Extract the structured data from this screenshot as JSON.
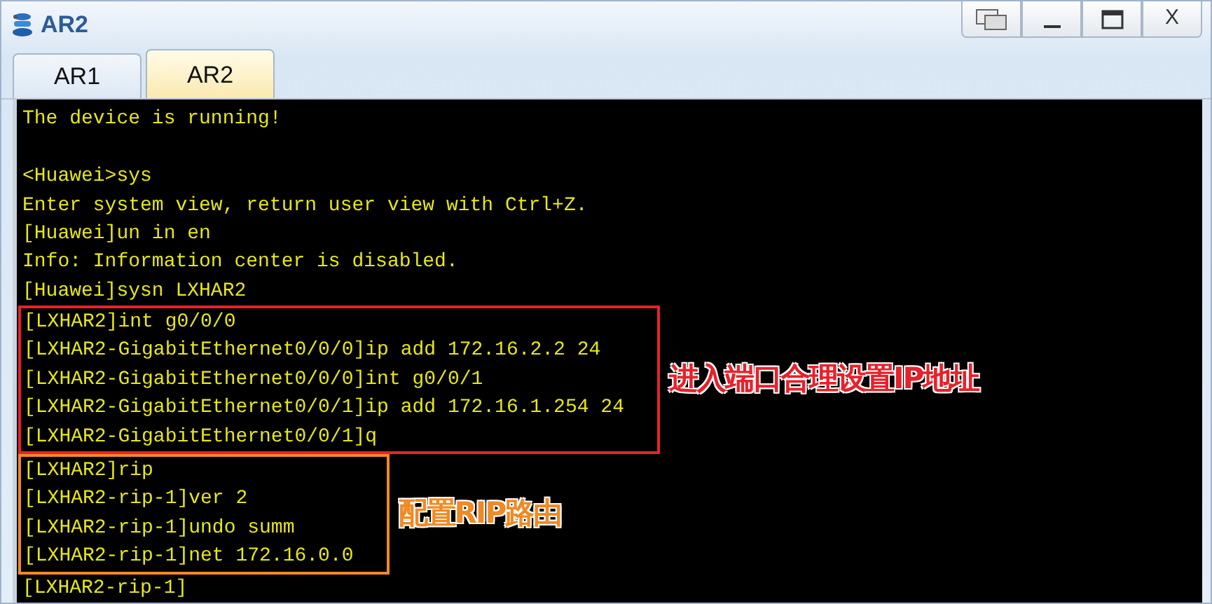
{
  "window": {
    "title": "AR2",
    "close_label": "X"
  },
  "tabs": [
    {
      "label": "AR1",
      "selected": false
    },
    {
      "label": "AR2",
      "selected": true
    }
  ],
  "terminal": {
    "blocks": [
      {
        "kind": "plain",
        "lines": [
          "The device is running!"
        ]
      },
      {
        "kind": "blank"
      },
      {
        "kind": "plain",
        "lines": [
          "<Huawei>sys",
          "Enter system view, return user view with Ctrl+Z.",
          "[Huawei]un in en",
          "Info: Information center is disabled.",
          "[Huawei]sysn LXHAR2"
        ]
      },
      {
        "kind": "annotated",
        "color": "#e8212a",
        "note": "进入端口合理设置IP地址",
        "lines": [
          "[LXHAR2]int g0/0/0",
          "[LXHAR2-GigabitEthernet0/0/0]ip add 172.16.2.2 24",
          "[LXHAR2-GigabitEthernet0/0/0]int g0/0/1",
          "[LXHAR2-GigabitEthernet0/0/1]ip add 172.16.1.254 24",
          "[LXHAR2-GigabitEthernet0/0/1]q"
        ]
      },
      {
        "kind": "annotated",
        "color": "#f08a24",
        "note": "配置RIP路由",
        "lines": [
          "[LXHAR2]rip",
          "[LXHAR2-rip-1]ver 2",
          "[LXHAR2-rip-1]undo summ",
          "[LXHAR2-rip-1]net 172.16.0.0"
        ]
      },
      {
        "kind": "plain",
        "lines": [
          "[LXHAR2-rip-1]"
        ]
      }
    ]
  }
}
